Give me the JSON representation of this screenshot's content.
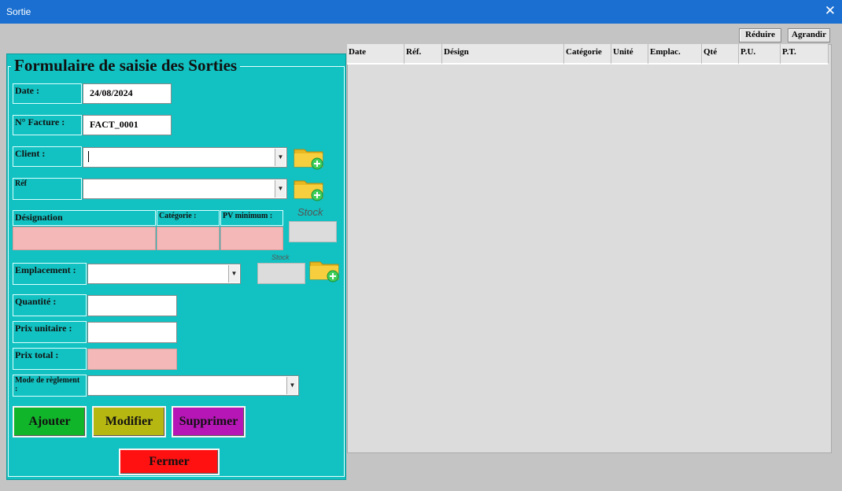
{
  "window": {
    "title": "Sortie",
    "close_glyph": "✕"
  },
  "form": {
    "title": "Formulaire de saisie des Sorties",
    "date_label": "Date :",
    "date_value": "24/08/2024",
    "invoice_label": "N° Facture :",
    "invoice_value": "FACT_0001",
    "client_label": "Client :",
    "client_value": "",
    "ref_label": "Réf",
    "ref_value": "",
    "designation_label": "Désignation",
    "category_label": "Catégorie :",
    "pv_min_label": "PV minimum :",
    "stock_label": "Stock",
    "location_label": "Emplacement :",
    "location_stock_label": "Stock",
    "quantity_label": "Quantité :",
    "unit_price_label": "Prix unitaire :",
    "total_price_label": "Prix total :",
    "payment_label": "Mode de règlement :",
    "buttons": {
      "add": "Ajouter",
      "edit": "Modifier",
      "delete": "Supprimer",
      "close": "Fermer"
    }
  },
  "toolbar": {
    "shrink": "Réduire",
    "enlarge": "Agrandir"
  },
  "table": {
    "columns": [
      "Date",
      "Réf.",
      "Désign",
      "Catégorie",
      "Unité",
      "Emplac.",
      "Qté",
      "P.U.",
      "P.T."
    ]
  },
  "colors": {
    "form_bg": "#12c1c1",
    "add": "#11b52a",
    "edit": "#b7b712",
    "delete": "#b516b5",
    "close": "#ff1111",
    "readonly": "#f4b8b8"
  },
  "icons": [
    "close-icon",
    "folder-add-icon",
    "dropdown-arrow-icon"
  ]
}
